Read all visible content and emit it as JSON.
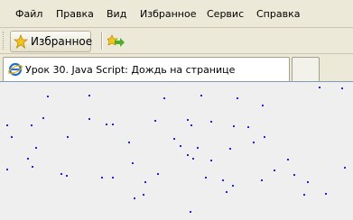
{
  "menu": {
    "items": [
      "Файл",
      "Правка",
      "Вид",
      "Избранное",
      "Сервис",
      "Справка"
    ]
  },
  "toolbar": {
    "favorites_label": "Избранное",
    "favorites_icon": "star-icon",
    "add_icon": "add-to-favorites-icon"
  },
  "tab": {
    "title": "Урок 30. Java Script: Дождь на странице",
    "icon": "ie-page-icon"
  },
  "colors": {
    "chrome": "#ece9d8",
    "content": "#efefef",
    "raindrop": "#2424e6"
  }
}
